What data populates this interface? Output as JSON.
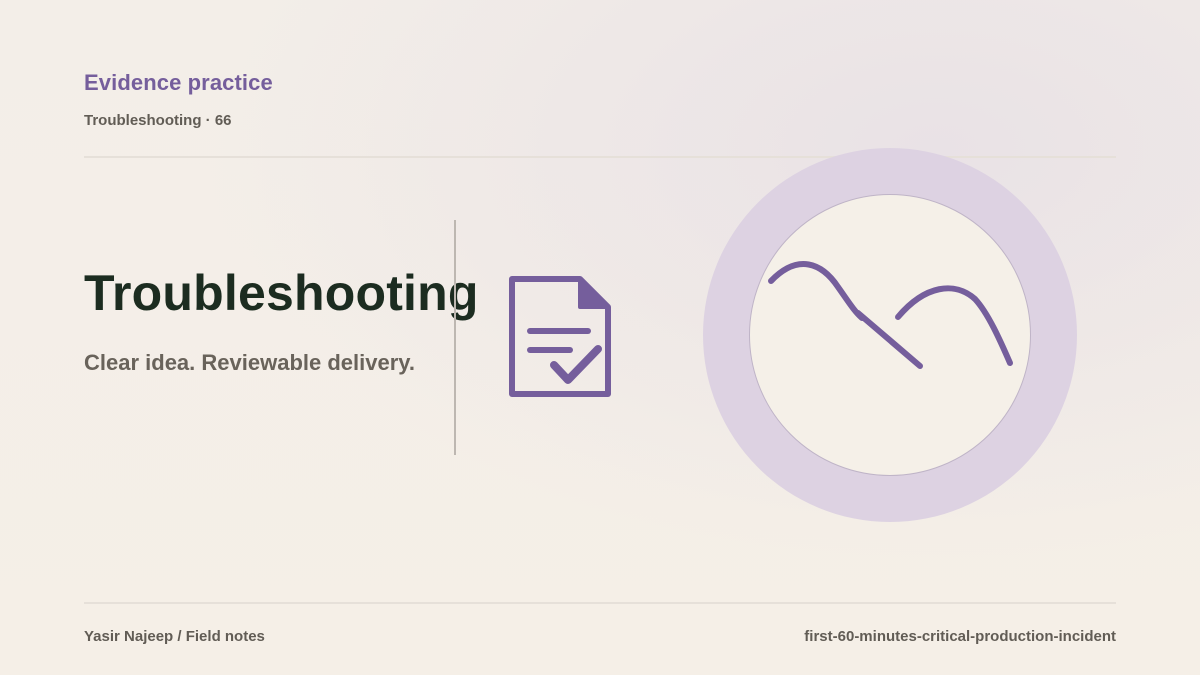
{
  "header": {
    "eyebrow": "Evidence practice",
    "meta": "Troubleshooting · 66"
  },
  "hero": {
    "title": "Troubleshooting",
    "tagline": "Clear idea. Reviewable delivery."
  },
  "icons": {
    "document": "document-check-icon",
    "illustration": "wave-line-icon"
  },
  "footer": {
    "author": "Yasir Najeep / Field notes",
    "slug": "first-60-minutes-critical-production-incident"
  },
  "colors": {
    "accent": "#755e9c",
    "title": "#1c2c20",
    "muted": "#615c55",
    "halo": "#ddd2e2",
    "background": "#f4efe8"
  }
}
